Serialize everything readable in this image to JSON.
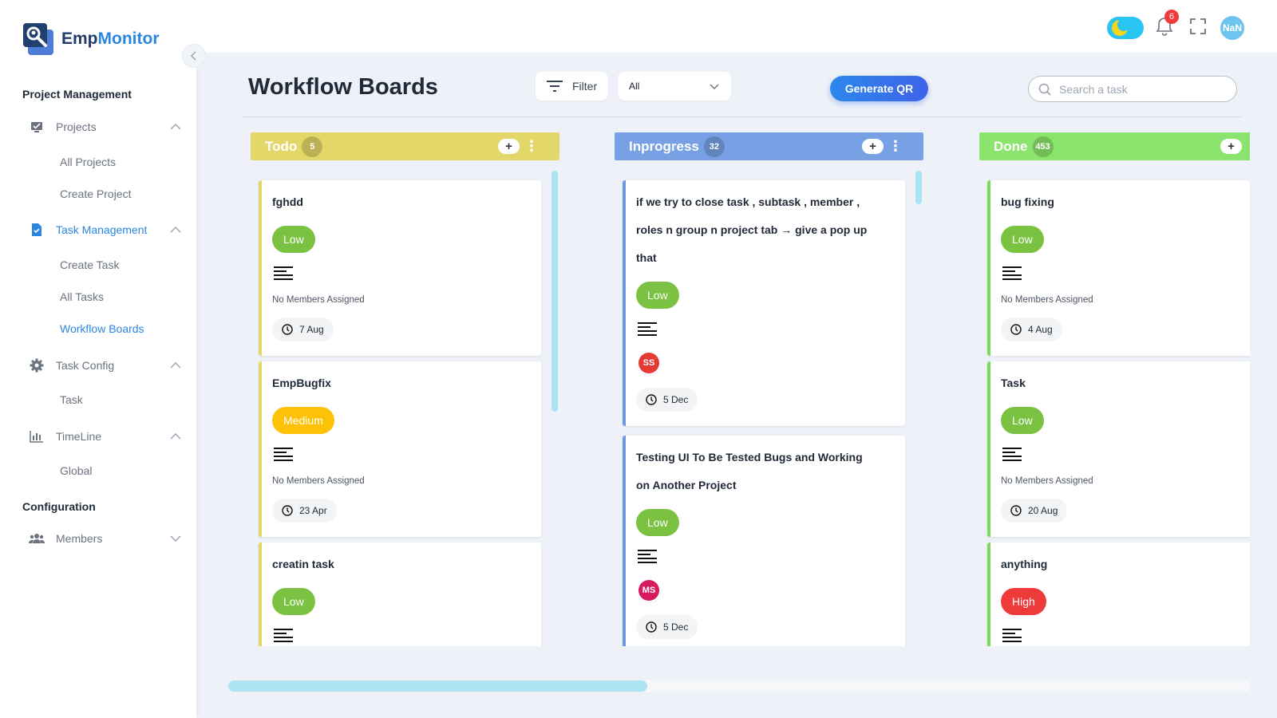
{
  "app": {
    "brand_prefix": "Emp",
    "brand_suffix": "Monitor"
  },
  "sidebar": {
    "section1": "Project Management",
    "projects": "Projects",
    "all_projects": "All Projects",
    "create_project": "Create Project",
    "task_management": "Task Management",
    "create_task": "Create Task",
    "all_tasks": "All Tasks",
    "workflow_boards": "Workflow Boards",
    "task_config": "Task Config",
    "task": "Task",
    "timeline": "TimeLine",
    "global": "Global",
    "section2": "Configuration",
    "members": "Members"
  },
  "topbar": {
    "notification_count": "6",
    "avatar_text": "NaN"
  },
  "header": {
    "title": "Workflow Boards",
    "filter_label": "Filter",
    "select_value": "All",
    "generate_qr": "Generate QR",
    "search_placeholder": "Search a task"
  },
  "columns": [
    {
      "name": "Todo",
      "count": "5",
      "color": "#e4d76a",
      "accent": "#e4d76a",
      "cards": [
        {
          "title": "fghdd",
          "priority": "Low",
          "members": "No Members Assigned",
          "date": "7 Aug"
        },
        {
          "title": "EmpBugfix",
          "priority": "Medium",
          "members": "No Members Assigned",
          "date": "23 Apr"
        },
        {
          "title": "creatin task",
          "priority": "Low"
        }
      ]
    },
    {
      "name": "Inprogress",
      "count": "32",
      "color": "#78a0e4",
      "accent": "#6f97de",
      "cards": [
        {
          "title_line1": "if we try to close task , subtask , member ,",
          "title_line2": "roles n group n project tab → give a pop up",
          "title_line3": "that",
          "priority": "Low",
          "avatar": "SS",
          "avatar_color": "#e53935",
          "date": "5 Dec"
        },
        {
          "title_line1": "Testing UI To Be Tested Bugs and Working",
          "title_line2": "on Another Project",
          "priority": "Low",
          "avatar": "MS",
          "avatar_color": "#d81b60",
          "date": "5 Dec"
        }
      ]
    },
    {
      "name": "Done",
      "count": "453",
      "color": "#8be46d",
      "accent": "#7fd860",
      "cards": [
        {
          "title": "bug fixing",
          "priority": "Low",
          "members": "No Members Assigned",
          "date": "4 Aug"
        },
        {
          "title": "Task",
          "priority": "Low",
          "members": "No Members Assigned",
          "date": "20 Aug"
        },
        {
          "title": "anything",
          "priority": "High"
        }
      ]
    }
  ],
  "colors": {
    "accent": "#2b86e0",
    "low": "#7bc242",
    "medium": "#fdc107",
    "high": "#ef3a3a"
  }
}
